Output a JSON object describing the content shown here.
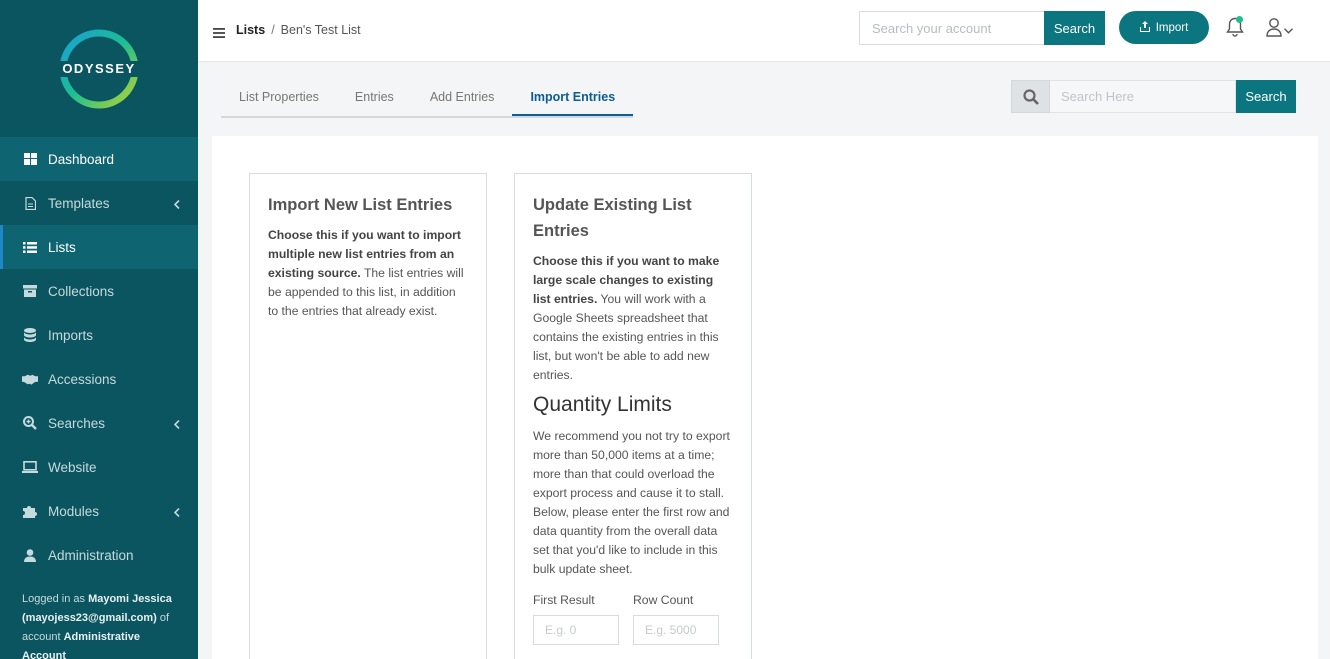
{
  "brand": {
    "logo_text": "ODYSSEY"
  },
  "sidebar": {
    "items": [
      {
        "label": "Dashboard",
        "icon": "dashboard-icon"
      },
      {
        "label": "Templates",
        "icon": "file-icon"
      },
      {
        "label": "Lists",
        "icon": "list-icon"
      },
      {
        "label": "Collections",
        "icon": "archive-icon"
      },
      {
        "label": "Imports",
        "icon": "database-icon"
      },
      {
        "label": "Accessions",
        "icon": "handshake-icon"
      },
      {
        "label": "Searches",
        "icon": "search-plus-icon"
      },
      {
        "label": "Website",
        "icon": "laptop-icon"
      },
      {
        "label": "Modules",
        "icon": "puzzle-icon"
      },
      {
        "label": "Administration",
        "icon": "user-icon"
      }
    ],
    "login": {
      "prefix": "Logged in as",
      "name": "Mayomi Jessica",
      "email": "(mayojess23@gmail.com)",
      "of_account": "of account",
      "account": "Administrative Account"
    }
  },
  "header": {
    "breadcrumb": {
      "root": "Lists",
      "separator": "/",
      "current": "Ben's Test List"
    },
    "search_placeholder": "Search your account",
    "search_label": "Search",
    "import_label": "Import"
  },
  "tabs": {
    "items": [
      "List Properties",
      "Entries",
      "Add Entries",
      "Import Entries"
    ],
    "active": "Import Entries",
    "search_placeholder": "Search Here",
    "search_label": "Search"
  },
  "cards": {
    "import_new": {
      "title": "Import New List Entries",
      "bold": "Choose this if you want to import multiple new list entries from an existing source.",
      "text": " The list entries will be appended to this list, in addition to the entries that already exist."
    },
    "update_existing": {
      "title": "Update Existing List Entries",
      "bold": "Choose this if you want to make large scale changes to existing list entries.",
      "text": " You will work with a Google Sheets spreadsheet that contains the existing entries in this list, but won't be able to add new entries.",
      "limits_title": "Quantity Limits",
      "limits_text": "We recommend you not try to export more than 50,000 items at a time; more than that could overload the export process and cause it to stall. Below, please enter the first row and data quantity from the overall data set that you'd like to include in this bulk update sheet.",
      "first_result_label": "First Result",
      "first_result_placeholder": "E.g. 0",
      "row_count_label": "Row Count",
      "row_count_placeholder": "E.g. 5000"
    }
  },
  "colors": {
    "sidebar": "#0b5560",
    "accent": "#0b7680",
    "active_tab": "#0b5d92"
  }
}
